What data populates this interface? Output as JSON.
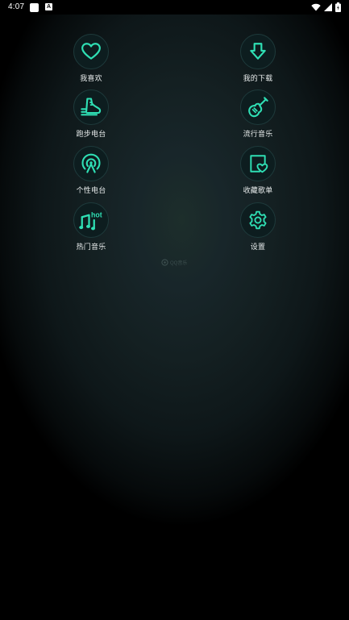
{
  "status_bar": {
    "time": "4:07",
    "notification_b_letter": "A",
    "icons": [
      "notification-icon",
      "app-a-icon",
      "wifi-icon",
      "signal-icon",
      "battery-icon"
    ]
  },
  "menu": {
    "items": [
      {
        "label": "我喜欢",
        "icon": "heart-icon"
      },
      {
        "label": "我的下载",
        "icon": "download-icon"
      },
      {
        "label": "跑步电台",
        "icon": "running-shoe-icon"
      },
      {
        "label": "流行音乐",
        "icon": "guitar-icon"
      },
      {
        "label": "个性电台",
        "icon": "radio-broadcast-icon"
      },
      {
        "label": "收藏歌单",
        "icon": "favorite-playlist-icon"
      },
      {
        "label": "热门音乐",
        "icon": "hot-music-note-icon"
      },
      {
        "label": "设置",
        "icon": "settings-gear-icon"
      }
    ]
  },
  "watermark": {
    "text": "QQ音乐"
  },
  "colors": {
    "accent": "#2fdfb4",
    "label_text": "#e8ecec",
    "circle_fill": "#0d1d1f",
    "circle_border": "#1e3a3b",
    "background": "#000000"
  }
}
